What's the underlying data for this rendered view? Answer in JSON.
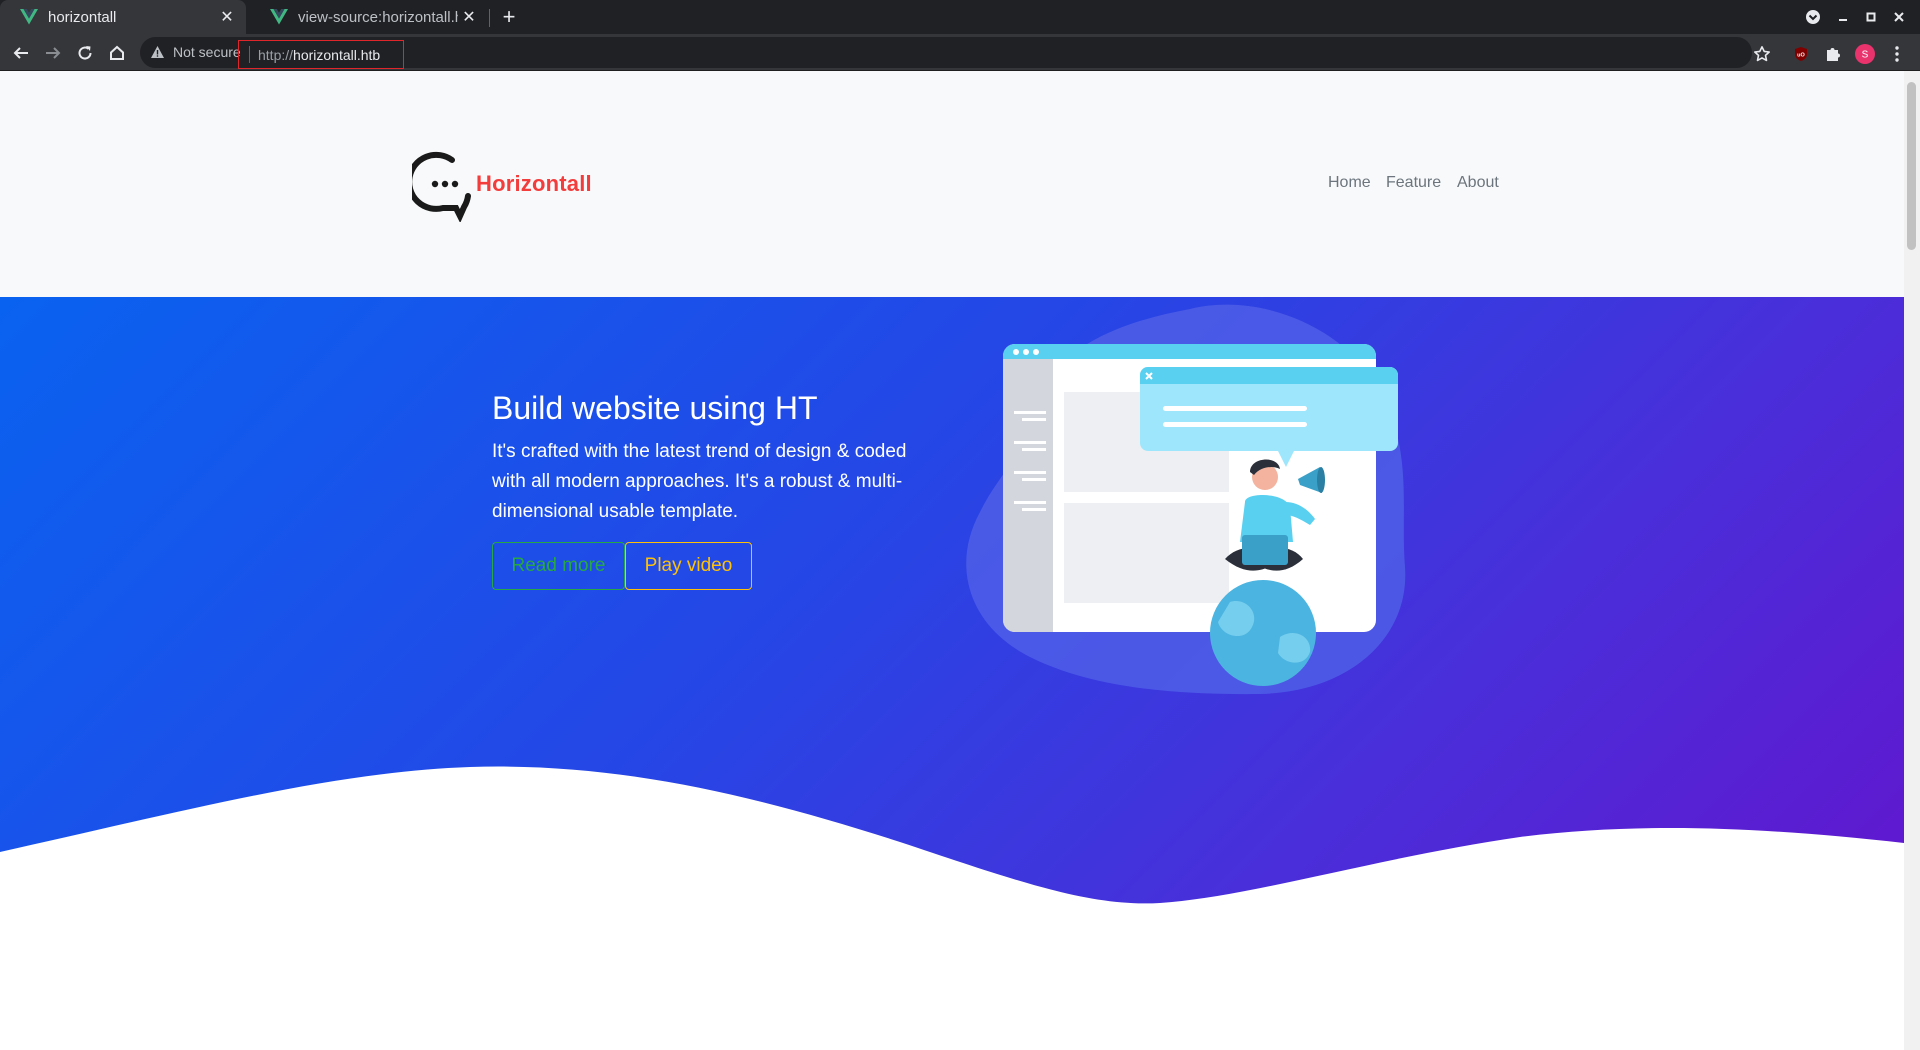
{
  "browser": {
    "tabs": [
      {
        "title": "horizontall",
        "active": true
      },
      {
        "title": "view-source:horizontall.ht",
        "active": false
      }
    ],
    "address_bar": {
      "security_label": "Not secure",
      "url_protocol": "http://",
      "url_host": "horizontall.htb"
    },
    "profile_initial": "S",
    "icons": {
      "back": "arrow-left-icon",
      "forward": "arrow-right-icon",
      "reload": "reload-icon",
      "home": "home-icon",
      "bookmark": "star-icon",
      "extension_ublock": "ublock-icon",
      "extensions": "puzzle-icon",
      "menu": "kebab-menu-icon"
    },
    "colors": {
      "chrome_dark": "#202124",
      "chrome_toolbar": "#35363a",
      "url_highlight": "#e0262a"
    }
  },
  "site": {
    "brand": {
      "name": "Horizontall",
      "color": "#f33d3d"
    },
    "nav": [
      {
        "label": "Home"
      },
      {
        "label": "Feature"
      },
      {
        "label": "About"
      }
    ],
    "hero": {
      "title": "Build website using HT",
      "text": "It's crafted with the latest trend of design & coded with all modern approaches. It's a robust & multi-dimensional usable template.",
      "buttons": {
        "read_more": "Read more",
        "play_video": "Play video"
      },
      "colors": {
        "gradient_start": "#0a62f0",
        "gradient_end": "#6612cc",
        "read_more": "#28a745",
        "play_video": "#ffc107"
      }
    }
  }
}
